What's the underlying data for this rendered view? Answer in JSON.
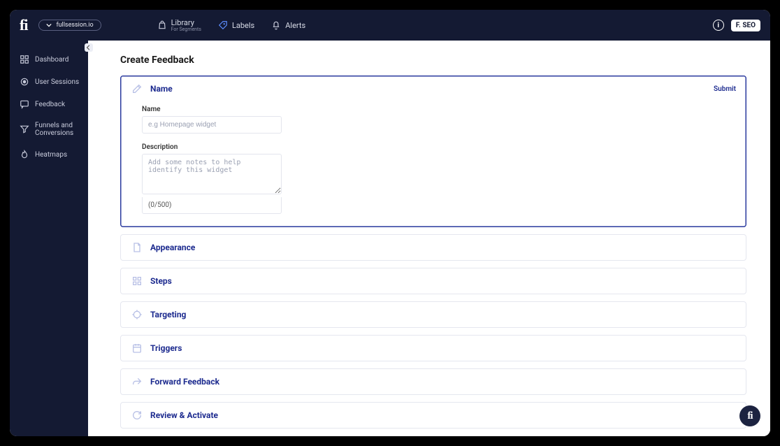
{
  "brand": {
    "logo_text": "fi",
    "domain": "fullsession.io",
    "float_badge": "fi"
  },
  "topnav": {
    "library": {
      "label": "Library",
      "sub": "For Segments"
    },
    "labels": {
      "label": "Labels"
    },
    "alerts": {
      "label": "Alerts"
    }
  },
  "user_badge": "F. SEO",
  "sidebar": {
    "dashboard": "Dashboard",
    "user_sessions": "User Sessions",
    "feedback": "Feedback",
    "funnels": "Funnels and Conversions",
    "heatmaps": "Heatmaps"
  },
  "page": {
    "title": "Create Feedback",
    "submit": "Submit"
  },
  "sections": {
    "name": {
      "title": "Name",
      "name_label": "Name",
      "name_placeholder": "e.g Homepage widget",
      "desc_label": "Description",
      "desc_placeholder": "Add some notes to help identify this widget",
      "counter": "(0/500)"
    },
    "appearance": {
      "title": "Appearance"
    },
    "steps": {
      "title": "Steps"
    },
    "targeting": {
      "title": "Targeting"
    },
    "triggers": {
      "title": "Triggers"
    },
    "forward": {
      "title": "Forward Feedback"
    },
    "review": {
      "title": "Review & Activate"
    }
  }
}
